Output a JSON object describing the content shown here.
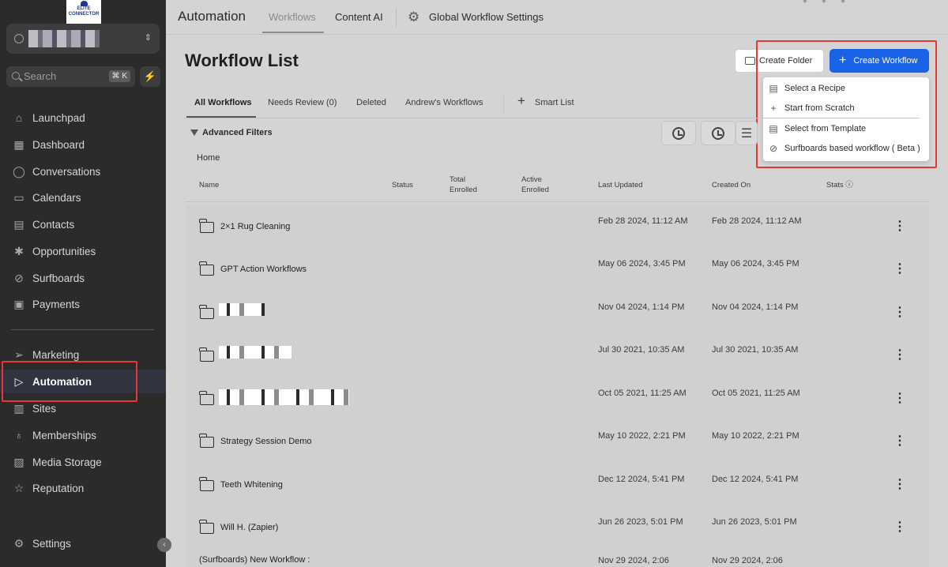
{
  "logo": {
    "line1": "ELITE",
    "line2": "CONNECTOR"
  },
  "sidebar": {
    "search_placeholder": "Search",
    "search_shortcut": "⌘ K",
    "items": [
      {
        "label": "Launchpad",
        "icon": "rocket-icon"
      },
      {
        "label": "Dashboard",
        "icon": "grid-icon"
      },
      {
        "label": "Conversations",
        "icon": "chat-icon"
      },
      {
        "label": "Calendars",
        "icon": "calendar-icon"
      },
      {
        "label": "Contacts",
        "icon": "contacts-icon"
      },
      {
        "label": "Opportunities",
        "icon": "opportunities-icon"
      },
      {
        "label": "Surfboards",
        "icon": "surfboard-icon"
      },
      {
        "label": "Payments",
        "icon": "payments-icon"
      },
      {
        "label": "Marketing",
        "icon": "send-icon"
      },
      {
        "label": "Automation",
        "icon": "automation-icon"
      },
      {
        "label": "Sites",
        "icon": "sites-icon"
      },
      {
        "label": "Memberships",
        "icon": "memberships-icon"
      },
      {
        "label": "Media Storage",
        "icon": "media-icon"
      },
      {
        "label": "Reputation",
        "icon": "star-icon"
      },
      {
        "label": "Settings",
        "icon": "settings-icon"
      }
    ],
    "active": "Automation"
  },
  "header": {
    "title": "Automation",
    "tabs": [
      "Workflows",
      "Content AI",
      "Global Workflow Settings"
    ]
  },
  "main": {
    "page_title": "Workflow List",
    "create_folder_label": "Create Folder",
    "create_workflow_label": "Create Workflow",
    "dropdown": [
      "Select a Recipe",
      "Start from Scratch",
      "Select from Template",
      "Surfboards based workflow ( Beta )"
    ],
    "subtabs": [
      "All Workflows",
      "Needs Review (0)",
      "Deleted",
      "Andrew's Workflows"
    ],
    "smart_list_label": "Smart List",
    "filters_label": "Advanced Filters",
    "breadcrumb": "Home",
    "columns": {
      "name": "Name",
      "status": "Status",
      "total_enrolled": "Total Enrolled",
      "active_enrolled": "Active Enrolled",
      "last_updated": "Last Updated",
      "created_on": "Created On",
      "stats": "Stats"
    },
    "rows": [
      {
        "name": "2×1 Rug Cleaning",
        "last_updated": "Feb 28 2024, 11:12 AM",
        "created_on": "Feb 28 2024, 11:12 AM"
      },
      {
        "name": "GPT Action Workflows",
        "last_updated": "May 06 2024, 3:45 PM",
        "created_on": "May 06 2024, 3:45 PM"
      },
      {
        "name": "",
        "last_updated": "Nov 04 2024, 1:14 PM",
        "created_on": "Nov 04 2024, 1:14 PM"
      },
      {
        "name": "",
        "last_updated": "Jul 30 2021, 10:35 AM",
        "created_on": "Jul 30 2021, 10:35 AM"
      },
      {
        "name": "",
        "last_updated": "Oct 05 2021, 11:25 AM",
        "created_on": "Oct 05 2021, 11:25 AM"
      },
      {
        "name": "Strategy Session Demo",
        "last_updated": "May 10 2022, 2:21 PM",
        "created_on": "May 10 2022, 2:21 PM"
      },
      {
        "name": "Teeth Whitening",
        "last_updated": "Dec 12 2024, 5:41 PM",
        "created_on": "Dec 12 2024, 5:41 PM"
      },
      {
        "name": "Will H. (Zapier)",
        "last_updated": "Jun 26 2023, 5:01 PM",
        "created_on": "Jun 26 2023, 5:01 PM"
      },
      {
        "name": "(Surfboards) New Workflow :",
        "last_updated": "Nov 29 2024, 2:06",
        "created_on": "Nov 29 2024, 2:06"
      }
    ]
  }
}
